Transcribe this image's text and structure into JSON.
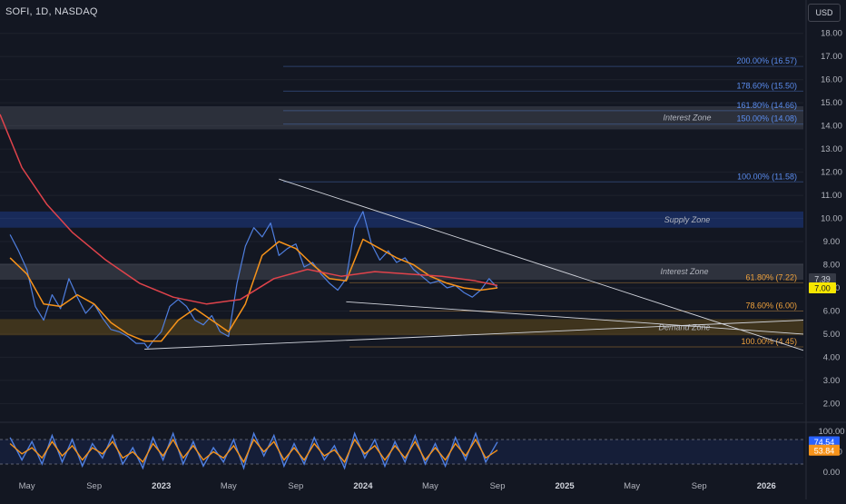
{
  "header": {
    "symbol_line": "SOFI, 1D, NASDAQ",
    "currency": "USD"
  },
  "colors": {
    "background": "#131722",
    "price": "#4f7fe0",
    "sma_fast": "#f7931a",
    "sma_slow": "#e0434b",
    "fib_blue": "#5b8def",
    "fib_orange": "#f0a23c",
    "zone_label": "#b2b5be",
    "last_price_tag": "#9598a1",
    "current_price_tag": "#f7e600",
    "stoch_k": "#4f7fe0",
    "stoch_d": "#f7931a"
  },
  "chart_data": [
    {
      "type": "line",
      "title": "",
      "x_ticks": [
        "May",
        "Sep",
        "2023",
        "May",
        "Sep",
        "2024",
        "May",
        "Sep",
        "2025",
        "May",
        "Sep",
        "2026"
      ],
      "y_ticks": [
        "18.00",
        "17.00",
        "16.00",
        "15.00",
        "14.00",
        "13.00",
        "12.00",
        "11.00",
        "10.00",
        "9.00",
        "8.00",
        "7.00",
        "6.00",
        "5.00",
        "4.00",
        "3.00",
        "2.00"
      ],
      "ylim": [
        1.7,
        18.5
      ],
      "x_unit": "month_index_from_2022_01",
      "xlim": [
        2.7,
        50.5
      ],
      "series": [
        {
          "role": "price",
          "x": [
            3.3,
            3.8,
            4.3,
            4.8,
            5.3,
            5.8,
            6.3,
            6.8,
            7.3,
            7.8,
            8.3,
            8.8,
            9.3,
            9.8,
            10.3,
            10.8,
            11.3,
            11.5,
            11.8,
            12.3,
            12.8,
            13.3,
            13.8,
            14.3,
            14.8,
            15.3,
            15.8,
            16.3,
            16.8,
            17.3,
            17.8,
            18.3,
            18.8,
            19.3,
            19.8,
            20.3,
            20.8,
            21.3,
            21.8,
            22.3,
            22.8,
            23.3,
            23.8,
            24.3,
            24.8,
            25.3,
            25.8,
            26.3,
            26.8,
            27.3,
            27.8,
            28.3,
            28.8,
            29.3,
            29.8,
            30.3,
            30.8,
            31.3,
            31.8,
            32.3
          ],
          "values": [
            9.3,
            8.6,
            7.8,
            6.2,
            5.6,
            6.7,
            6.1,
            7.4,
            6.6,
            5.9,
            6.3,
            5.7,
            5.2,
            5.1,
            4.9,
            4.6,
            4.6,
            4.4,
            4.7,
            5.1,
            6.2,
            6.5,
            6.2,
            5.6,
            5.4,
            5.8,
            5.1,
            4.9,
            7.2,
            8.8,
            9.6,
            9.2,
            9.8,
            8.4,
            8.7,
            8.9,
            7.9,
            8.1,
            7.6,
            7.2,
            6.9,
            7.4,
            9.6,
            10.3,
            8.9,
            8.2,
            8.6,
            8.1,
            8.3,
            7.8,
            7.5,
            7.2,
            7.3,
            7.0,
            7.1,
            6.8,
            6.6,
            6.9,
            7.4,
            7.0
          ]
        },
        {
          "role": "sma_fast",
          "x": [
            3.3,
            4.3,
            5.3,
            6.3,
            7.3,
            8.3,
            9.3,
            10.3,
            11.3,
            12.3,
            13.3,
            14.3,
            15.3,
            16.3,
            17.3,
            18.3,
            19.3,
            20.3,
            21.3,
            22.3,
            23.3,
            24.3,
            25.3,
            26.3,
            27.3,
            28.3,
            29.3,
            30.3,
            31.3,
            32.3
          ],
          "values": [
            8.3,
            7.6,
            6.3,
            6.2,
            6.7,
            6.3,
            5.5,
            5.0,
            4.7,
            4.7,
            5.6,
            6.1,
            5.6,
            5.1,
            6.3,
            8.4,
            9.0,
            8.7,
            8.0,
            7.4,
            7.3,
            9.1,
            8.7,
            8.3,
            8.0,
            7.5,
            7.2,
            7.0,
            6.9,
            7.0
          ]
        },
        {
          "role": "sma_slow",
          "x": [
            2.7,
            4.0,
            5.5,
            7.0,
            9.0,
            11.0,
            13.0,
            15.0,
            17.0,
            19.0,
            21.0,
            23.0,
            25.0,
            27.0,
            29.0,
            31.0,
            32.3
          ],
          "values": [
            14.5,
            12.2,
            10.6,
            9.4,
            8.2,
            7.2,
            6.6,
            6.3,
            6.5,
            7.4,
            7.8,
            7.5,
            7.7,
            7.6,
            7.5,
            7.3,
            7.1
          ]
        },
        {
          "role": "triangle_upper",
          "x": [
            19.3,
            50.5
          ],
          "values": [
            11.7,
            4.3
          ]
        },
        {
          "role": "triangle_lower_left",
          "x": [
            11.3,
            50.5
          ],
          "values": [
            4.35,
            5.6
          ]
        },
        {
          "role": "triangle_lower_right",
          "x": [
            23.3,
            50.5
          ],
          "values": [
            6.4,
            5.0
          ]
        }
      ],
      "zones": [
        {
          "label": "Interest Zone",
          "y0": 13.85,
          "y1": 14.85,
          "color": "#787b86"
        },
        {
          "label": "Supply Zone",
          "y0": 9.6,
          "y1": 10.3,
          "color": "#2962ff"
        },
        {
          "label": "Interest Zone",
          "y0": 7.35,
          "y1": 8.05,
          "color": "#787b86"
        },
        {
          "label": "Demand Zone",
          "y0": 4.95,
          "y1": 5.65,
          "color": "#c58a10"
        }
      ],
      "fib_levels": [
        {
          "label": "200.00% (16.57)",
          "value": 16.57,
          "color": "#5b8def"
        },
        {
          "label": "178.60% (15.50)",
          "value": 15.5,
          "color": "#5b8def"
        },
        {
          "label": "161.80% (14.66)",
          "value": 14.66,
          "color": "#5b8def"
        },
        {
          "label": "150.00% (14.08)",
          "value": 14.08,
          "color": "#5b8def"
        },
        {
          "label": "100.00% (11.58)",
          "value": 11.58,
          "color": "#5b8def"
        },
        {
          "label": "61.80% (7.22)",
          "value": 7.22,
          "color": "#f0a23c"
        },
        {
          "label": "78.60% (6.00)",
          "value": 6.0,
          "color": "#f0a23c"
        },
        {
          "label": "100.00% (4.45)",
          "value": 4.45,
          "color": "#f0a23c"
        }
      ],
      "price_tags": [
        {
          "label": "7.39",
          "value": 7.39,
          "color": "#363a45",
          "text_color": "#d1d4dc"
        },
        {
          "label": "7.00",
          "value": 7.0,
          "color": "#f7e600",
          "text_color": "#131722"
        }
      ]
    },
    {
      "type": "line",
      "title": "",
      "y_ticks": [
        "100.00",
        "50.00",
        "0.00"
      ],
      "ylim": [
        0,
        100
      ],
      "bands": [
        80,
        20
      ],
      "series": [
        {
          "role": "stoch_k",
          "x": [
            3.3,
            4.0,
            4.6,
            5.2,
            5.8,
            6.4,
            7.0,
            7.6,
            8.2,
            8.8,
            9.4,
            10.0,
            10.6,
            11.2,
            11.8,
            12.4,
            13.0,
            13.6,
            14.2,
            14.8,
            15.4,
            16.0,
            16.6,
            17.2,
            17.8,
            18.4,
            19.0,
            19.6,
            20.2,
            20.8,
            21.4,
            22.0,
            22.6,
            23.2,
            23.8,
            24.4,
            25.0,
            25.6,
            26.2,
            26.8,
            27.4,
            28.0,
            28.6,
            29.2,
            29.8,
            30.4,
            31.0,
            31.6,
            32.3
          ],
          "values": [
            85,
            30,
            75,
            20,
            90,
            25,
            80,
            15,
            70,
            35,
            90,
            20,
            60,
            10,
            85,
            30,
            95,
            20,
            75,
            15,
            60,
            25,
            80,
            10,
            95,
            40,
            90,
            15,
            70,
            20,
            85,
            30,
            65,
            10,
            95,
            35,
            80,
            15,
            75,
            25,
            90,
            20,
            70,
            15,
            85,
            30,
            95,
            25,
            74
          ]
        },
        {
          "role": "stoch_d",
          "x": [
            3.3,
            4.0,
            4.6,
            5.2,
            5.8,
            6.4,
            7.0,
            7.6,
            8.2,
            8.8,
            9.4,
            10.0,
            10.6,
            11.2,
            11.8,
            12.4,
            13.0,
            13.6,
            14.2,
            14.8,
            15.4,
            16.0,
            16.6,
            17.2,
            17.8,
            18.4,
            19.0,
            19.6,
            20.2,
            20.8,
            21.4,
            22.0,
            22.6,
            23.2,
            23.8,
            24.4,
            25.0,
            25.6,
            26.2,
            26.8,
            27.4,
            28.0,
            28.6,
            29.2,
            29.8,
            30.4,
            31.0,
            31.6,
            32.3
          ],
          "values": [
            70,
            45,
            60,
            35,
            75,
            40,
            65,
            30,
            60,
            45,
            75,
            35,
            50,
            25,
            70,
            40,
            80,
            35,
            65,
            30,
            50,
            35,
            65,
            25,
            80,
            50,
            75,
            30,
            60,
            30,
            70,
            40,
            55,
            25,
            80,
            45,
            65,
            30,
            65,
            35,
            75,
            30,
            60,
            30,
            70,
            40,
            80,
            35,
            54
          ]
        }
      ],
      "price_tags": [
        {
          "label": "74.54",
          "value": 74.54,
          "color": "#2962ff",
          "text_color": "#ffffff"
        },
        {
          "label": "53.84",
          "value": 53.84,
          "color": "#f7931a",
          "text_color": "#ffffff"
        }
      ]
    }
  ]
}
